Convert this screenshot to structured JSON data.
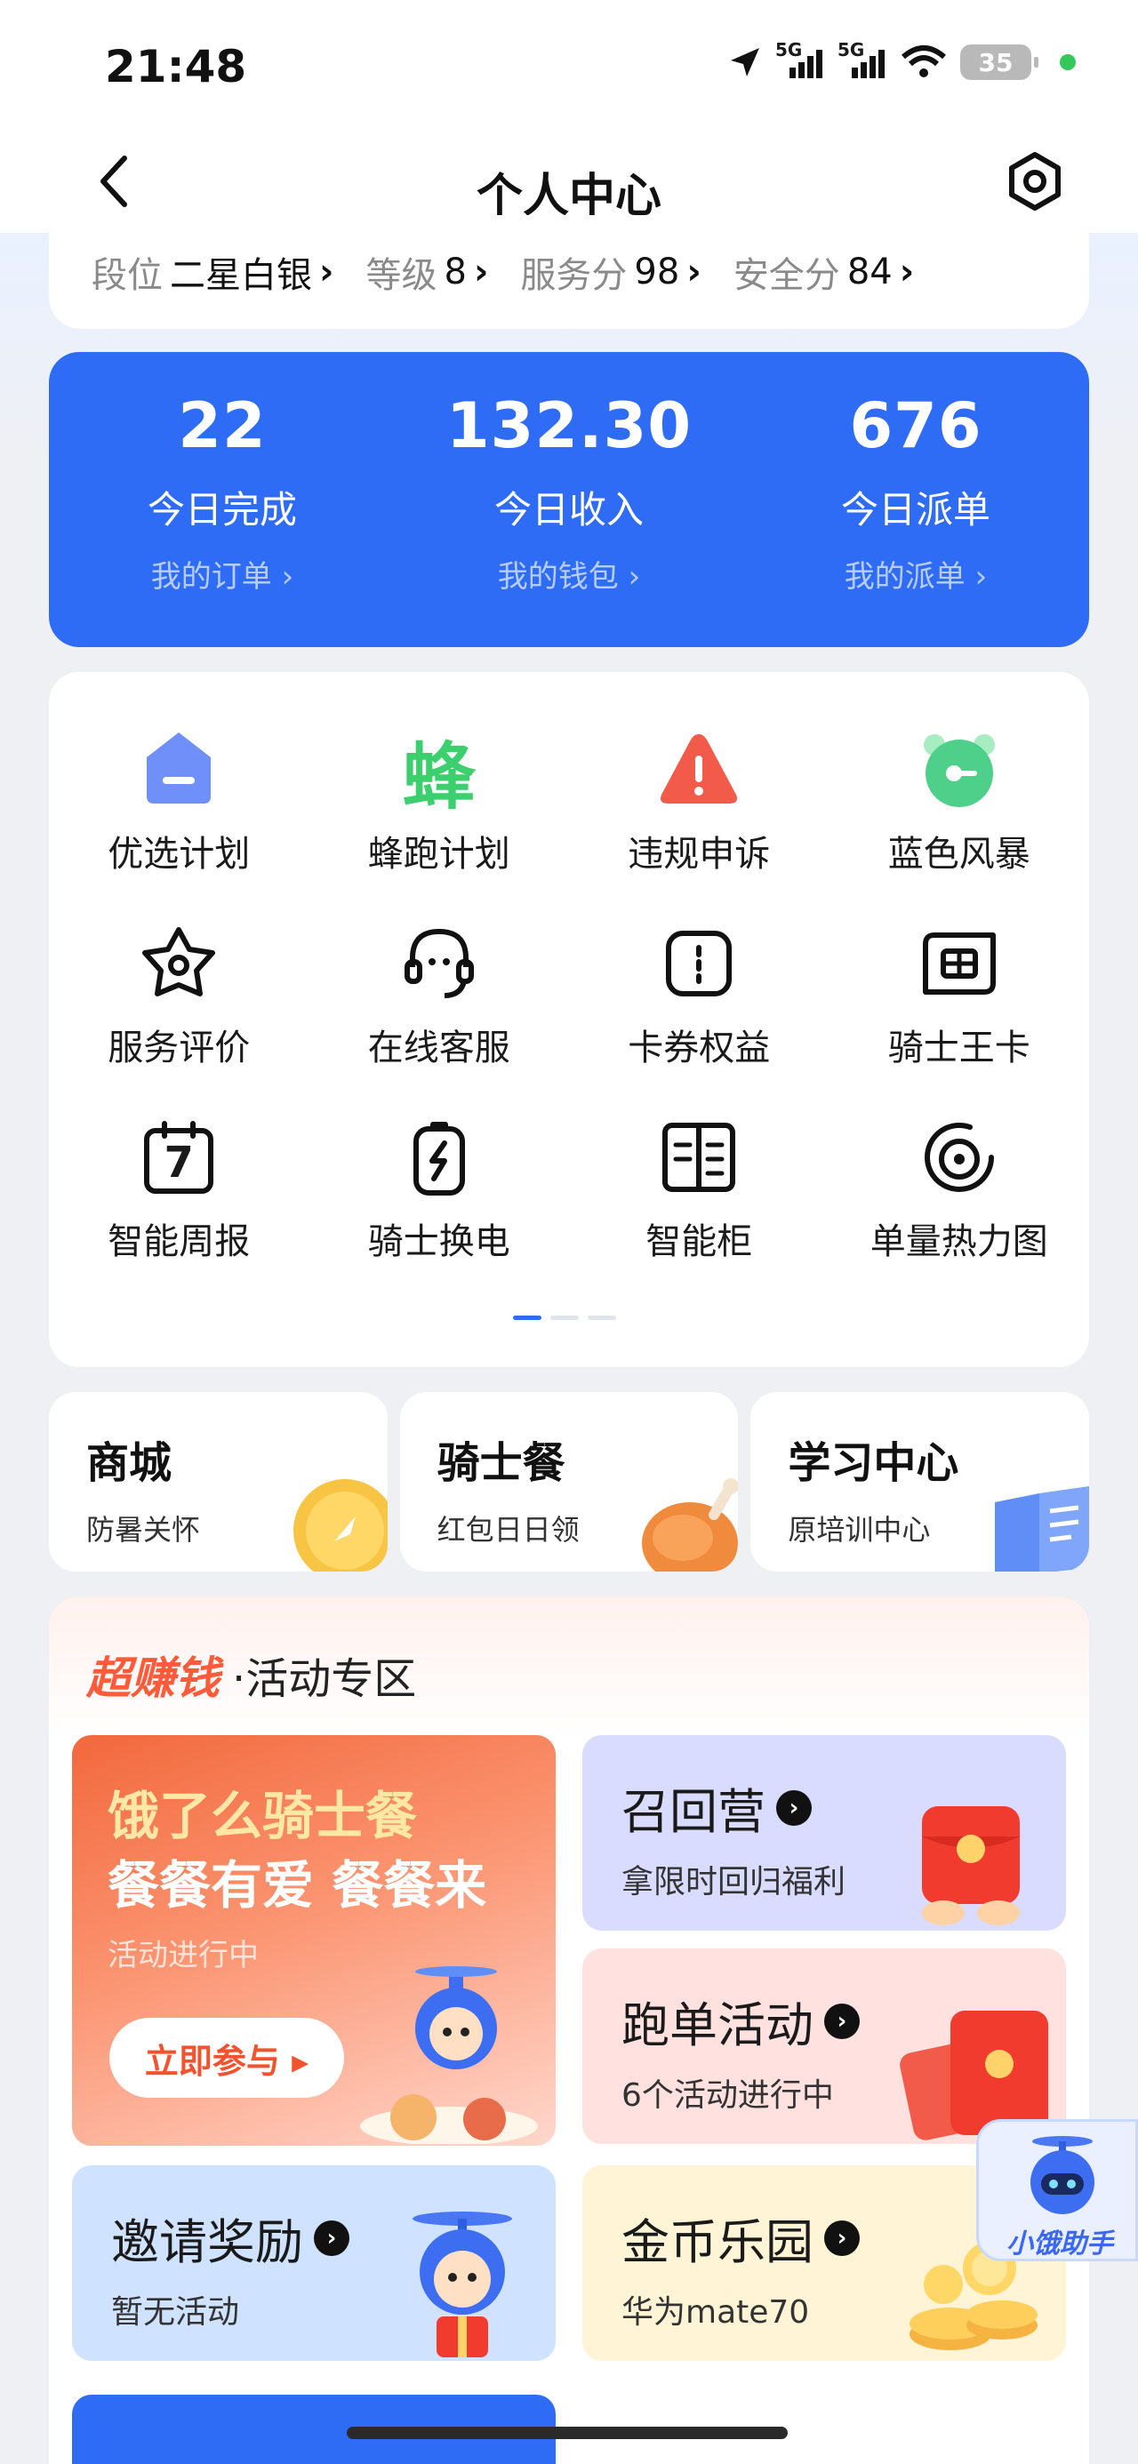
{
  "status_bar": {
    "time": "21:48",
    "network_1": "5G",
    "network_2": "5G",
    "battery": "35"
  },
  "nav": {
    "title": "个人中心",
    "back_icon": "chevron-left-icon",
    "settings_icon": "settings-hexagon-icon"
  },
  "rank": [
    {
      "label": "段位",
      "value": "二星白银"
    },
    {
      "label": "等级",
      "value": "8"
    },
    {
      "label": "服务分",
      "value": "98"
    },
    {
      "label": "安全分",
      "value": "84"
    }
  ],
  "stats": [
    {
      "value": "22",
      "label": "今日完成",
      "link": "我的订单 ›"
    },
    {
      "value": "132.30",
      "label": "今日收入",
      "link": "我的钱包 ›"
    },
    {
      "value": "676",
      "label": "今日派单",
      "link": "我的派单 ›"
    }
  ],
  "grid_items": [
    {
      "label": "优选计划",
      "icon": "crown-icon"
    },
    {
      "label": "蜂跑计划",
      "icon": "bee-char-icon",
      "glyph": "蜂"
    },
    {
      "label": "违规申诉",
      "icon": "warning-icon"
    },
    {
      "label": "蓝色风暴",
      "icon": "alarm-clock-icon"
    },
    {
      "label": "服务评价",
      "icon": "star-badge-icon"
    },
    {
      "label": "在线客服",
      "icon": "headset-icon"
    },
    {
      "label": "卡券权益",
      "icon": "coupon-icon"
    },
    {
      "label": "骑士王卡",
      "icon": "sim-card-icon"
    },
    {
      "label": "智能周报",
      "icon": "calendar-icon",
      "glyph": "7"
    },
    {
      "label": "骑士换电",
      "icon": "battery-swap-icon"
    },
    {
      "label": "智能柜",
      "icon": "locker-icon"
    },
    {
      "label": "单量热力图",
      "icon": "target-icon"
    }
  ],
  "mini_cards": [
    {
      "title": "商城",
      "sub": "防暑关怀",
      "icon": "gold-coin-icon"
    },
    {
      "title": "骑士餐",
      "sub": "红包日日领",
      "icon": "chicken-leg-icon"
    },
    {
      "title": "学习中心",
      "sub": "原培训中心",
      "icon": "book-icon"
    }
  ],
  "promo": {
    "brand": "超赚钱",
    "title": "·活动专区",
    "hero": {
      "line1": "饿了么骑士餐",
      "line2": "餐餐有爱 餐餐来",
      "status": "活动进行中",
      "button": "立即参与 ▸"
    },
    "tiles": [
      {
        "title": "召回营",
        "sub": "拿限时回归福利",
        "icon": "red-envelope-icon"
      },
      {
        "title": "跑单活动",
        "sub": "6个活动进行中",
        "icon": "red-envelope-icon"
      },
      {
        "title": "邀请奖励",
        "sub": "暂无活动",
        "icon": "rider-mascot-icon"
      },
      {
        "title": "金币乐园",
        "sub": "华为mate70",
        "icon": "coins-icon"
      }
    ]
  },
  "assistant": {
    "label": "小饿助手"
  },
  "colors": {
    "primary": "#2f6cf6",
    "promo_red": "#ff5b3a"
  }
}
